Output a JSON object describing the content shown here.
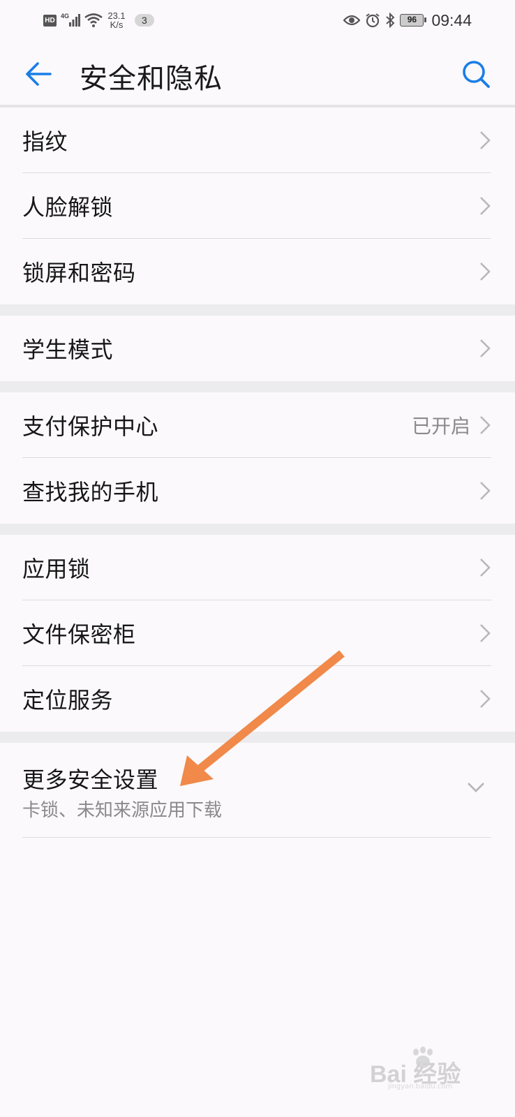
{
  "status_bar": {
    "hd": "HD",
    "network": "4G",
    "speed_value": "23.1",
    "speed_unit": "K/s",
    "notification_count": "3",
    "battery": "96",
    "time": "09:44"
  },
  "header": {
    "title": "安全和隐私"
  },
  "groups": [
    {
      "items": [
        {
          "label": "指纹"
        },
        {
          "label": "人脸解锁"
        },
        {
          "label": "锁屏和密码"
        }
      ]
    },
    {
      "items": [
        {
          "label": "学生模式"
        }
      ]
    },
    {
      "items": [
        {
          "label": "支付保护中心",
          "status": "已开启"
        },
        {
          "label": "查找我的手机"
        }
      ]
    },
    {
      "items": [
        {
          "label": "应用锁"
        },
        {
          "label": "文件保密柜"
        },
        {
          "label": "定位服务"
        }
      ]
    }
  ],
  "more_settings": {
    "label": "更多安全设置",
    "subtitle": "卡锁、未知来源应用下载"
  },
  "watermark": {
    "brand": "Bai 经验",
    "url": "jingyan.baidu.com"
  },
  "colors": {
    "accent": "#1a7ee6",
    "annotation_arrow": "#f0894a",
    "background": "#fbf9fc",
    "group_gap": "#ecebee"
  }
}
